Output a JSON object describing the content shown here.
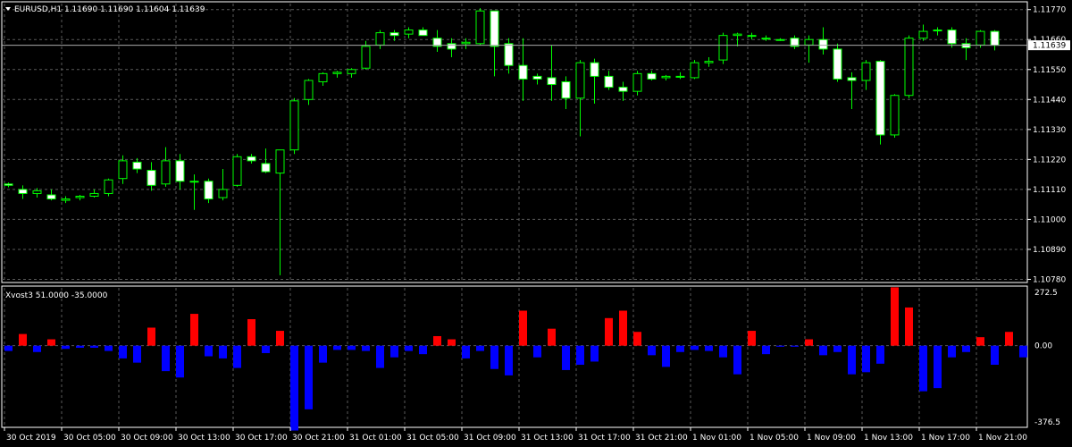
{
  "header": {
    "symbol_line": "EURUSD,H1  1.11690 1.11690 1.11604 1.11639",
    "indicator_line": "Xvost3 51.0000 -35.0000"
  },
  "colors": {
    "background": "#000000",
    "frame": "#ffffff",
    "grid": "#5a5a5a",
    "bull_candle": "#00ff00",
    "bull_body": "#000000",
    "bear_body": "#ffffff",
    "hist_pos": "#0000ff",
    "hist_neg": "#ff0000"
  },
  "chart_data": [
    {
      "type": "candlestick",
      "symbol": "EURUSD",
      "timeframe": "H1",
      "price_axis_ticks": [
        "1.11770",
        "1.11660",
        "1.11550",
        "1.11440",
        "1.11330",
        "1.11220",
        "1.11110",
        "1.11000",
        "1.10890",
        "1.10780"
      ],
      "current_price": "1.11639",
      "ylim": [
        1.10775,
        1.11792
      ],
      "grid": true,
      "candles": [
        {
          "o": 1.1113,
          "h": 1.11135,
          "l": 1.11118,
          "c": 1.11125
        },
        {
          "o": 1.1111,
          "h": 1.11125,
          "l": 1.11075,
          "c": 1.11095
        },
        {
          "o": 1.11095,
          "h": 1.11115,
          "l": 1.1108,
          "c": 1.11105
        },
        {
          "o": 1.1109,
          "h": 1.1111,
          "l": 1.1107,
          "c": 1.11075
        },
        {
          "o": 1.1107,
          "h": 1.11085,
          "l": 1.1106,
          "c": 1.11075
        },
        {
          "o": 1.1108,
          "h": 1.1109,
          "l": 1.1107,
          "c": 1.11085
        },
        {
          "o": 1.11085,
          "h": 1.1111,
          "l": 1.1108,
          "c": 1.11095
        },
        {
          "o": 1.11095,
          "h": 1.1115,
          "l": 1.11085,
          "c": 1.11145
        },
        {
          "o": 1.1115,
          "h": 1.11235,
          "l": 1.1113,
          "c": 1.11215
        },
        {
          "o": 1.1121,
          "h": 1.11225,
          "l": 1.1117,
          "c": 1.11185
        },
        {
          "o": 1.1118,
          "h": 1.1121,
          "l": 1.11105,
          "c": 1.11125
        },
        {
          "o": 1.1113,
          "h": 1.11265,
          "l": 1.1112,
          "c": 1.11215
        },
        {
          "o": 1.11215,
          "h": 1.1124,
          "l": 1.1111,
          "c": 1.1114
        },
        {
          "o": 1.1114,
          "h": 1.11165,
          "l": 1.11035,
          "c": 1.1114
        },
        {
          "o": 1.1114,
          "h": 1.1115,
          "l": 1.1106,
          "c": 1.11075
        },
        {
          "o": 1.1108,
          "h": 1.11185,
          "l": 1.1107,
          "c": 1.1111
        },
        {
          "o": 1.11125,
          "h": 1.1124,
          "l": 1.1112,
          "c": 1.1123
        },
        {
          "o": 1.1123,
          "h": 1.1124,
          "l": 1.11205,
          "c": 1.11215
        },
        {
          "o": 1.11205,
          "h": 1.1126,
          "l": 1.1117,
          "c": 1.11175
        },
        {
          "o": 1.1117,
          "h": 1.11255,
          "l": 1.10795,
          "c": 1.11255
        },
        {
          "o": 1.11255,
          "h": 1.11445,
          "l": 1.1124,
          "c": 1.11435
        },
        {
          "o": 1.1144,
          "h": 1.11515,
          "l": 1.1142,
          "c": 1.1151
        },
        {
          "o": 1.11505,
          "h": 1.1154,
          "l": 1.1149,
          "c": 1.11535
        },
        {
          "o": 1.11535,
          "h": 1.11545,
          "l": 1.1152,
          "c": 1.1154
        },
        {
          "o": 1.11535,
          "h": 1.11555,
          "l": 1.1152,
          "c": 1.1155
        },
        {
          "o": 1.11555,
          "h": 1.11655,
          "l": 1.1155,
          "c": 1.11635
        },
        {
          "o": 1.1164,
          "h": 1.11695,
          "l": 1.11625,
          "c": 1.11685
        },
        {
          "o": 1.11685,
          "h": 1.11695,
          "l": 1.11655,
          "c": 1.11675
        },
        {
          "o": 1.1168,
          "h": 1.11705,
          "l": 1.11665,
          "c": 1.11695
        },
        {
          "o": 1.11695,
          "h": 1.11705,
          "l": 1.11675,
          "c": 1.11675
        },
        {
          "o": 1.11665,
          "h": 1.11695,
          "l": 1.11615,
          "c": 1.11635
        },
        {
          "o": 1.11645,
          "h": 1.11665,
          "l": 1.11595,
          "c": 1.11625
        },
        {
          "o": 1.11645,
          "h": 1.11665,
          "l": 1.11625,
          "c": 1.1165
        },
        {
          "o": 1.11645,
          "h": 1.11775,
          "l": 1.1164,
          "c": 1.11765
        },
        {
          "o": 1.11765,
          "h": 1.11765,
          "l": 1.11525,
          "c": 1.11635
        },
        {
          "o": 1.11645,
          "h": 1.11665,
          "l": 1.11535,
          "c": 1.11565
        },
        {
          "o": 1.11565,
          "h": 1.11665,
          "l": 1.11435,
          "c": 1.11515
        },
        {
          "o": 1.11525,
          "h": 1.11535,
          "l": 1.11495,
          "c": 1.11515
        },
        {
          "o": 1.1152,
          "h": 1.1164,
          "l": 1.11435,
          "c": 1.11495
        },
        {
          "o": 1.11505,
          "h": 1.11525,
          "l": 1.11405,
          "c": 1.11445
        },
        {
          "o": 1.11445,
          "h": 1.11585,
          "l": 1.11305,
          "c": 1.11575
        },
        {
          "o": 1.11575,
          "h": 1.1159,
          "l": 1.11425,
          "c": 1.11525
        },
        {
          "o": 1.11525,
          "h": 1.11545,
          "l": 1.11475,
          "c": 1.11485
        },
        {
          "o": 1.11485,
          "h": 1.11505,
          "l": 1.11435,
          "c": 1.1147
        },
        {
          "o": 1.1147,
          "h": 1.11545,
          "l": 1.11455,
          "c": 1.11535
        },
        {
          "o": 1.11535,
          "h": 1.11545,
          "l": 1.1151,
          "c": 1.11515
        },
        {
          "o": 1.1152,
          "h": 1.1153,
          "l": 1.1151,
          "c": 1.11525
        },
        {
          "o": 1.11525,
          "h": 1.1154,
          "l": 1.11515,
          "c": 1.11525
        },
        {
          "o": 1.1152,
          "h": 1.11585,
          "l": 1.11515,
          "c": 1.11575
        },
        {
          "o": 1.11575,
          "h": 1.11595,
          "l": 1.1156,
          "c": 1.1158
        },
        {
          "o": 1.11585,
          "h": 1.11685,
          "l": 1.1157,
          "c": 1.11675
        },
        {
          "o": 1.11675,
          "h": 1.11685,
          "l": 1.11635,
          "c": 1.1168
        },
        {
          "o": 1.11675,
          "h": 1.11685,
          "l": 1.1166,
          "c": 1.11675
        },
        {
          "o": 1.11665,
          "h": 1.11675,
          "l": 1.11655,
          "c": 1.11665
        },
        {
          "o": 1.1166,
          "h": 1.11665,
          "l": 1.11655,
          "c": 1.1166
        },
        {
          "o": 1.11665,
          "h": 1.11675,
          "l": 1.11625,
          "c": 1.11635
        },
        {
          "o": 1.1164,
          "h": 1.11675,
          "l": 1.11575,
          "c": 1.1166
        },
        {
          "o": 1.1166,
          "h": 1.11705,
          "l": 1.11605,
          "c": 1.11625
        },
        {
          "o": 1.11625,
          "h": 1.11645,
          "l": 1.11505,
          "c": 1.11515
        },
        {
          "o": 1.1152,
          "h": 1.1154,
          "l": 1.11405,
          "c": 1.1151
        },
        {
          "o": 1.1151,
          "h": 1.11585,
          "l": 1.11475,
          "c": 1.11575
        },
        {
          "o": 1.1158,
          "h": 1.11585,
          "l": 1.11275,
          "c": 1.1131
        },
        {
          "o": 1.1131,
          "h": 1.1146,
          "l": 1.113,
          "c": 1.11455
        },
        {
          "o": 1.11455,
          "h": 1.11675,
          "l": 1.11445,
          "c": 1.11665
        },
        {
          "o": 1.11665,
          "h": 1.11715,
          "l": 1.11655,
          "c": 1.1169
        },
        {
          "o": 1.11695,
          "h": 1.11705,
          "l": 1.11675,
          "c": 1.11695
        },
        {
          "o": 1.11695,
          "h": 1.11705,
          "l": 1.1163,
          "c": 1.11645
        },
        {
          "o": 1.11645,
          "h": 1.11665,
          "l": 1.11585,
          "c": 1.1163
        },
        {
          "o": 1.1164,
          "h": 1.11695,
          "l": 1.1163,
          "c": 1.1169
        },
        {
          "o": 1.1169,
          "h": 1.11695,
          "l": 1.1162,
          "c": 1.11639
        }
      ]
    },
    {
      "type": "bar",
      "name": "Xvost3",
      "params": "51.0000 -35.0000",
      "y_ticks": [
        "272.5",
        "0.00",
        "-376.5"
      ],
      "ylim": [
        -376.5,
        272.5
      ],
      "values": [
        -25,
        55,
        -30,
        30,
        -15,
        -10,
        -10,
        -25,
        -60,
        -80,
        85,
        -120,
        -150,
        150,
        -50,
        -60,
        -105,
        125,
        -35,
        70,
        -400,
        -300,
        -80,
        -20,
        -20,
        -25,
        -105,
        -55,
        -25,
        -40,
        45,
        30,
        -60,
        -25,
        -110,
        -140,
        165,
        -55,
        80,
        -115,
        -90,
        -75,
        130,
        165,
        65,
        -45,
        -100,
        -30,
        -20,
        -25,
        -55,
        -135,
        70,
        -40,
        -5,
        -5,
        30,
        -45,
        -30,
        -135,
        -125,
        -85,
        275,
        180,
        -215,
        -200,
        -55,
        -30,
        40,
        -90,
        65,
        -55
      ]
    },
    {
      "type": "time_axis",
      "labels": [
        "30 Oct 2019",
        "30 Oct 05:00",
        "30 Oct 09:00",
        "30 Oct 13:00",
        "30 Oct 17:00",
        "30 Oct 21:00",
        "31 Oct 01:00",
        "31 Oct 05:00",
        "31 Oct 09:00",
        "31 Oct 13:00",
        "31 Oct 17:00",
        "31 Oct 21:00",
        "1 Nov 01:00",
        "1 Nov 05:00",
        "1 Nov 09:00",
        "1 Nov 13:00",
        "1 Nov 17:00",
        "1 Nov 21:00"
      ]
    }
  ]
}
